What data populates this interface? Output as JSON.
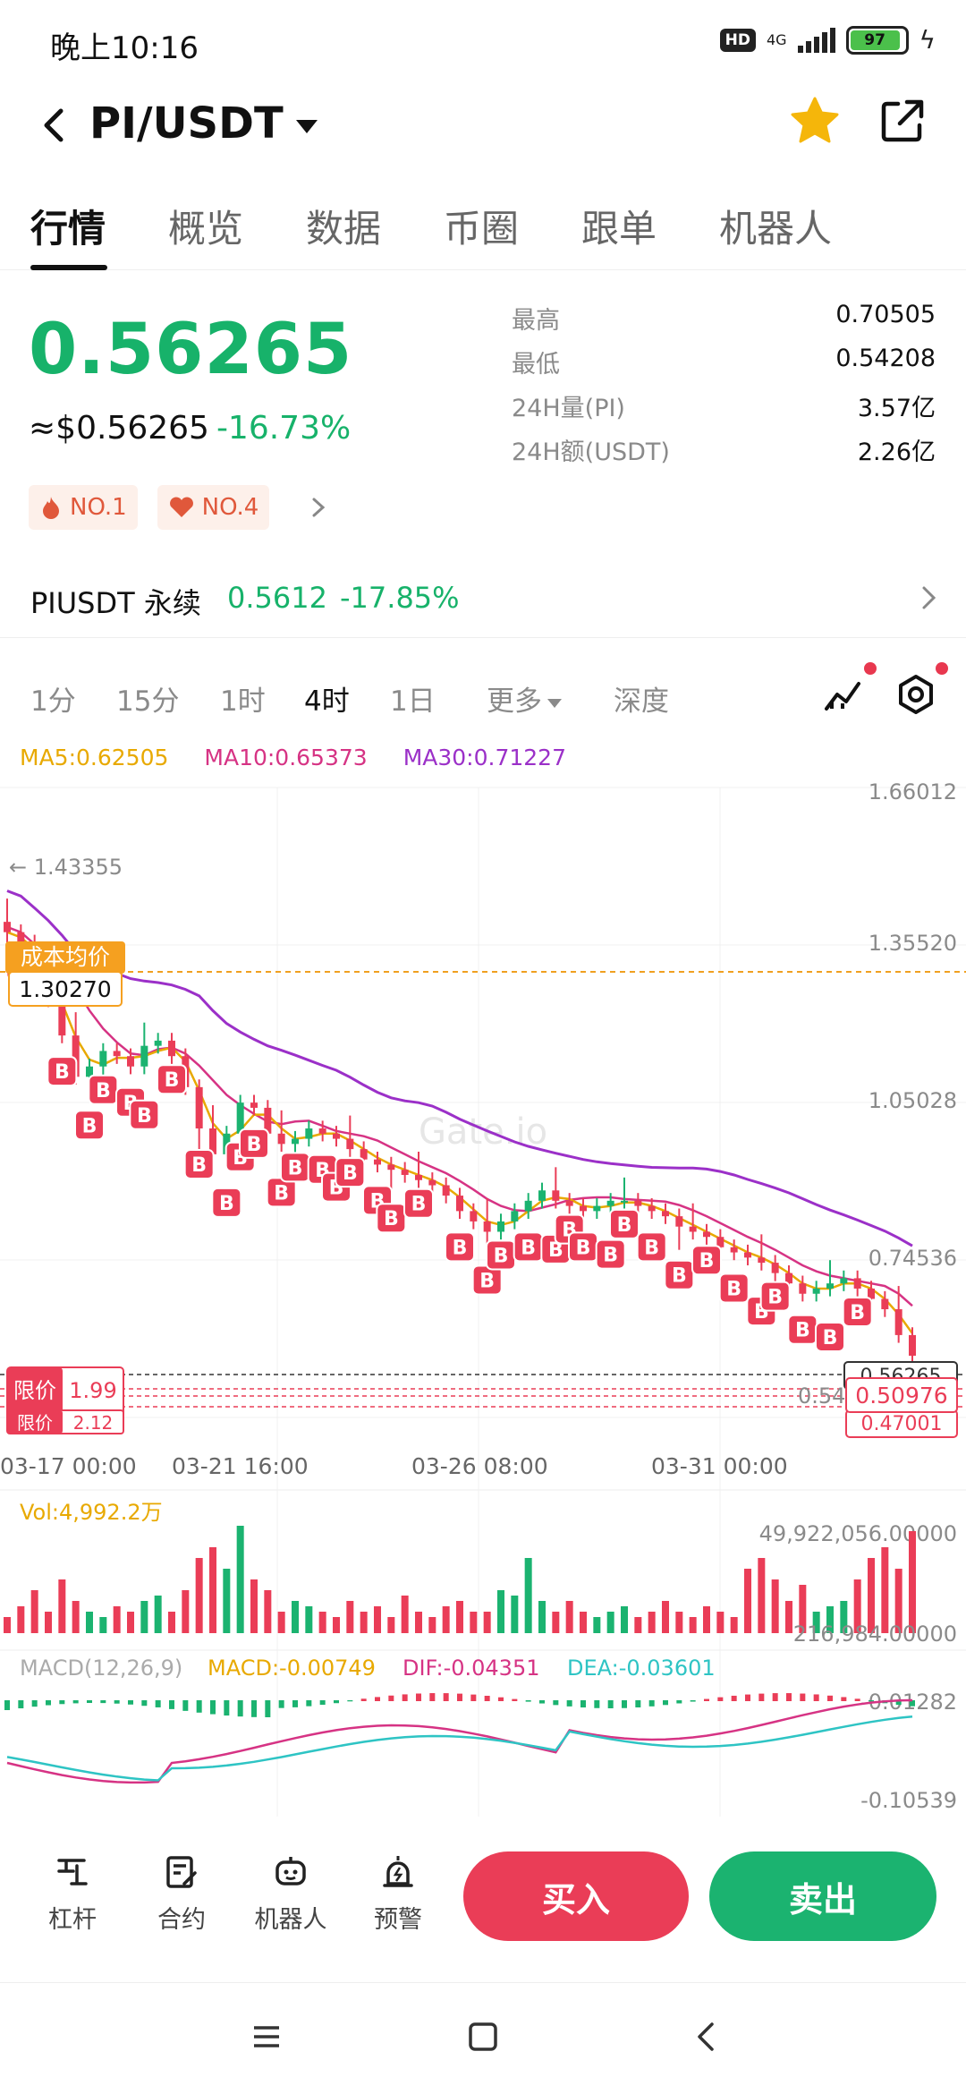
{
  "status_bar": {
    "time": "晚上10:16",
    "hd": "HD",
    "network": "4G",
    "battery": "97"
  },
  "nav": {
    "pair": "PI/USDT"
  },
  "tabs": [
    {
      "label": "行情",
      "active": true
    },
    {
      "label": "概览",
      "active": false
    },
    {
      "label": "数据",
      "active": false
    },
    {
      "label": "币圈",
      "active": false
    },
    {
      "label": "跟单",
      "active": false
    },
    {
      "label": "机器人",
      "active": false
    }
  ],
  "ticker": {
    "last_price": "0.56265",
    "usd_price": "≈$0.56265",
    "change_pct": "-16.73%",
    "stats": [
      {
        "label": "最高",
        "value": "0.70505"
      },
      {
        "label": "最低",
        "value": "0.54208"
      },
      {
        "label": "24H量(PI)",
        "value": "3.57亿"
      },
      {
        "label": "24H额(USDT)",
        "value": "2.26亿"
      }
    ],
    "ranks": [
      "NO.1",
      "NO.4"
    ]
  },
  "perpetual": {
    "name": "PIUSDT 永续",
    "price": "0.5612",
    "change": "-17.85%"
  },
  "intervals": {
    "items": [
      "1分",
      "15分",
      "1时",
      "4时",
      "1日",
      "更多",
      "深度"
    ],
    "active": "4时"
  },
  "ma_legend": {
    "ma5": "MA5:0.62505",
    "ma10": "MA10:0.65373",
    "ma30": "MA30:0.71227"
  },
  "colors": {
    "up": "#1bb370",
    "down": "#ea3d57",
    "ma5": "#e8a900",
    "ma10": "#d63384",
    "ma30": "#9b30c8",
    "dif": "#d63384",
    "dea": "#2ec4c4"
  },
  "chart_data": {
    "type": "candlestick",
    "price_axis": [
      "1.66012",
      "1.35520",
      "1.05028",
      "0.74536"
    ],
    "time_axis": [
      "03-17 00:00",
      "03-21 16:00",
      "03-26 08:00",
      "03-31 00:00"
    ],
    "high_marker": "← 1.43355",
    "cost_label": "成本均价",
    "cost_value": "1.30270",
    "limit_labels": [
      "限价",
      "限价"
    ],
    "limit_values": [
      "1.99",
      "2.12"
    ],
    "current_price_tag": "0.56265",
    "order_price_tag": "0.50976",
    "hidden_price_tag": "0.47001",
    "partial_price": "0.54",
    "marker": "B",
    "watermark": "Gate.io",
    "closes": [
      1.38,
      1.36,
      1.3,
      1.25,
      1.18,
      1.1,
      1.12,
      1.15,
      1.14,
      1.12,
      1.16,
      1.17,
      1.14,
      1.08,
      1.0,
      0.95,
      0.99,
      1.05,
      1.04,
      0.99,
      0.97,
      0.98,
      1.0,
      0.99,
      0.98,
      0.96,
      0.94,
      0.93,
      0.92,
      0.91,
      0.9,
      0.89,
      0.87,
      0.84,
      0.82,
      0.8,
      0.82,
      0.84,
      0.86,
      0.88,
      0.86,
      0.85,
      0.84,
      0.85,
      0.86,
      0.86,
      0.85,
      0.84,
      0.83,
      0.81,
      0.8,
      0.79,
      0.77,
      0.76,
      0.75,
      0.74,
      0.72,
      0.7,
      0.68,
      0.69,
      0.7,
      0.71,
      0.69,
      0.67,
      0.65,
      0.6,
      0.56
    ],
    "volume_label": "Vol:4,992.2万",
    "volume_axis_top": "49,922,056.00000",
    "volume_axis_bottom": "216,984.00000",
    "macd_label": "MACD(12,26,9)",
    "macd_value": "MACD:-0.00749",
    "dif_value": "DIF:-0.04351",
    "dea_value": "DEA:-0.03601",
    "macd_axis_top": "-0.01282",
    "macd_axis_bottom": "-0.10539"
  },
  "bottom_bar": {
    "items": [
      {
        "label": "杠杆",
        "icon": "leverage-icon"
      },
      {
        "label": "合约",
        "icon": "contract-icon"
      },
      {
        "label": "机器人",
        "icon": "robot-icon"
      },
      {
        "label": "预警",
        "icon": "alarm-icon"
      }
    ],
    "buy": "买入",
    "sell": "卖出"
  }
}
